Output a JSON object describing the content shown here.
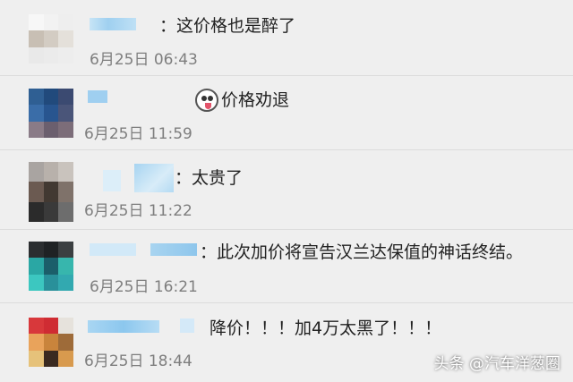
{
  "comments": [
    {
      "message": "：这价格也是醉了",
      "date": "6月25日 06:43"
    },
    {
      "message": "价格劝退",
      "date": "6月25日 11:59",
      "emoji": "sticker-face-icon"
    },
    {
      "message": "：太贵了",
      "date": "6月25日 11:22"
    },
    {
      "message": "：此次加价将宣告汉兰达保值的神话终结。",
      "date": "6月25日 16:21"
    },
    {
      "message": "降价！！！加4万太黑了！！！",
      "date": "6月25日 18:44"
    }
  ],
  "watermark": "头条 @汽车洋葱圈",
  "colors": {
    "background": "#efefef",
    "date_text": "#7e7e7e",
    "message_text": "#222222",
    "name_blur": "#a9d3ef"
  }
}
